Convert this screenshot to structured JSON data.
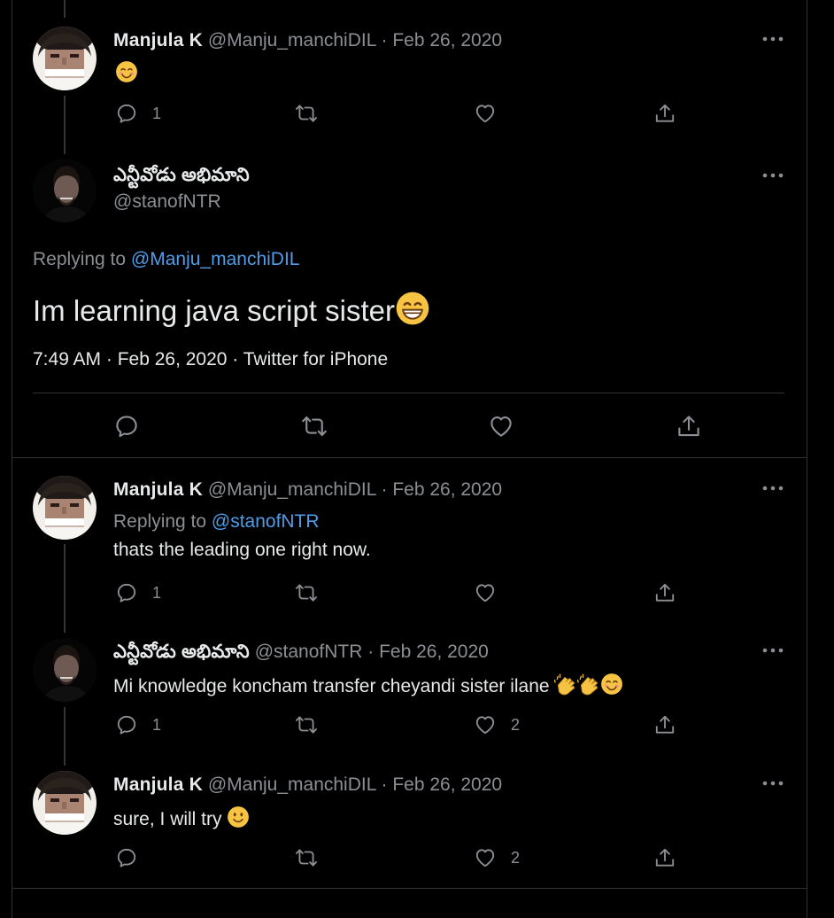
{
  "tweets": [
    {
      "name": "Manjula K",
      "handle": "@Manju_manchiDIL",
      "separator": "·",
      "date": "Feb 26, 2020",
      "text_emoji": "smiling-face-emoji",
      "reply_count": "1",
      "retweet_count": "",
      "like_count": "",
      "icons": [
        "reply-icon",
        "retweet-icon",
        "like-icon",
        "share-icon",
        "more-icon"
      ]
    },
    {
      "name": "ఎన్టీవోడు అభిమాని",
      "handle": "@stanofNTR",
      "replying_prefix": "Replying to",
      "replying_to": "@Manju_manchiDIL",
      "text": "Im learning  java script sister",
      "text_emoji": "grinning-face-emoji",
      "timestamp": "7:49 AM · Feb 26, 2020 · Twitter for iPhone"
    },
    {
      "name": "Manjula K",
      "handle": "@Manju_manchiDIL",
      "separator": "·",
      "date": "Feb 26, 2020",
      "replying_prefix": "Replying to",
      "replying_to": "@stanofNTR",
      "text": "thats the leading one right now.",
      "reply_count": "1"
    },
    {
      "name": "ఎన్టీవోడు అభిమాని",
      "handle": "@stanofNTR",
      "separator": "·",
      "date": "Feb 26, 2020",
      "text": "Mi knowledge koncham transfer cheyandi sister ilane",
      "text_emojis": [
        "clapping-hands-emoji",
        "clapping-hands-emoji",
        "smiling-face-emoji"
      ],
      "reply_count": "1",
      "like_count": "2"
    },
    {
      "name": "Manjula K",
      "handle": "@Manju_manchiDIL",
      "separator": "·",
      "date": "Feb 26, 2020",
      "text": "sure, I will try",
      "text_emoji": "slightly-smiling-face-emoji",
      "like_count": "2"
    }
  ],
  "colors": {
    "background": "#000000",
    "text": "#e7e9ea",
    "muted": "#8b8f94",
    "link": "#4f9de8",
    "divider": "#2f3336",
    "emoji": "#f6c343"
  }
}
